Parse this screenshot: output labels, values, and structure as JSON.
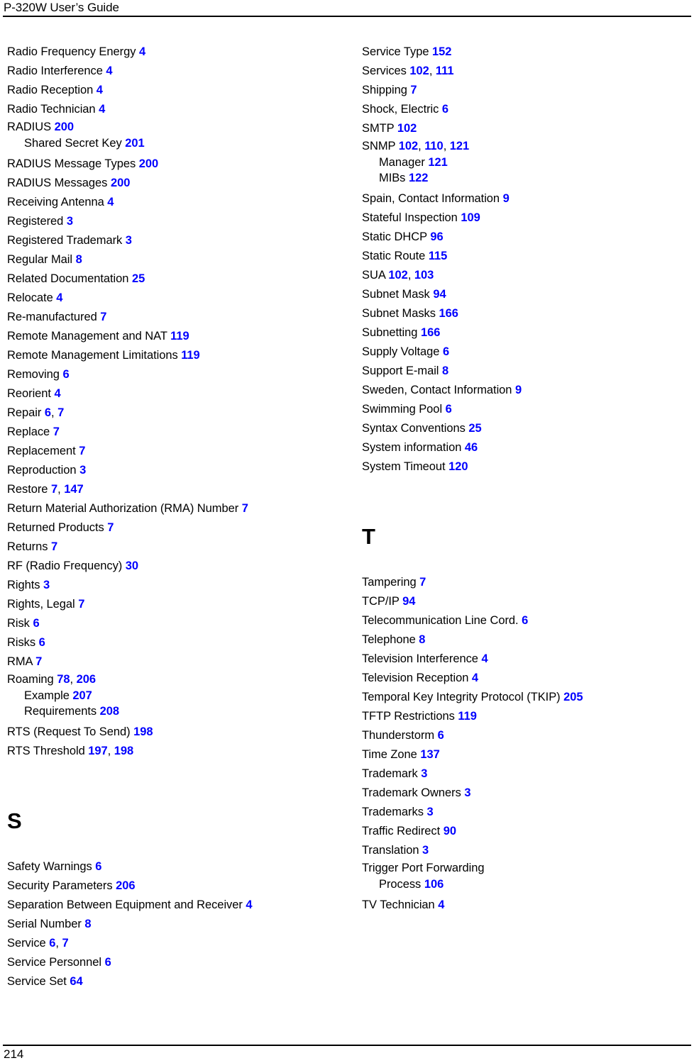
{
  "header": {
    "title": "P-320W User’s Guide"
  },
  "footer": {
    "page_number": "214"
  },
  "style": {
    "page_ref_color": "#0000ff",
    "text_color": "#000000",
    "background": "#ffffff"
  },
  "columns": [
    {
      "name": "left",
      "sections": [
        {
          "letter": null,
          "entries": [
            {
              "term": "Radio Frequency Energy",
              "pages": [
                "4"
              ],
              "level": 0
            },
            {
              "term": "Radio Interference",
              "pages": [
                "4"
              ],
              "level": 0
            },
            {
              "term": "Radio Reception",
              "pages": [
                "4"
              ],
              "level": 0
            },
            {
              "term": "Radio Technician",
              "pages": [
                "4"
              ],
              "level": 0
            },
            {
              "term": "RADIUS",
              "pages": [
                "200"
              ],
              "level": 0
            },
            {
              "term": "Shared Secret Key",
              "pages": [
                "201"
              ],
              "level": 1
            },
            {
              "term": "RADIUS Message Types",
              "pages": [
                "200"
              ],
              "level": 0
            },
            {
              "term": "RADIUS Messages",
              "pages": [
                "200"
              ],
              "level": 0
            },
            {
              "term": "Receiving Antenna",
              "pages": [
                "4"
              ],
              "level": 0
            },
            {
              "term": "Registered",
              "pages": [
                "3"
              ],
              "level": 0
            },
            {
              "term": "Registered Trademark",
              "pages": [
                "3"
              ],
              "level": 0
            },
            {
              "term": "Regular Mail",
              "pages": [
                "8"
              ],
              "level": 0
            },
            {
              "term": "Related Documentation",
              "pages": [
                "25"
              ],
              "level": 0
            },
            {
              "term": "Relocate",
              "pages": [
                "4"
              ],
              "level": 0
            },
            {
              "term": "Re-manufactured",
              "pages": [
                "7"
              ],
              "level": 0
            },
            {
              "term": "Remote Management and NAT",
              "pages": [
                "119"
              ],
              "level": 0
            },
            {
              "term": "Remote Management Limitations",
              "pages": [
                "119"
              ],
              "level": 0
            },
            {
              "term": "Removing",
              "pages": [
                "6"
              ],
              "level": 0
            },
            {
              "term": "Reorient",
              "pages": [
                "4"
              ],
              "level": 0
            },
            {
              "term": "Repair",
              "pages": [
                "6",
                "7"
              ],
              "level": 0
            },
            {
              "term": "Replace",
              "pages": [
                "7"
              ],
              "level": 0
            },
            {
              "term": "Replacement",
              "pages": [
                "7"
              ],
              "level": 0
            },
            {
              "term": "Reproduction",
              "pages": [
                "3"
              ],
              "level": 0
            },
            {
              "term": "Restore",
              "pages": [
                "7",
                "147"
              ],
              "level": 0
            },
            {
              "term": "Return Material Authorization (RMA) Number",
              "pages": [
                "7"
              ],
              "level": 0
            },
            {
              "term": "Returned Products",
              "pages": [
                "7"
              ],
              "level": 0
            },
            {
              "term": "Returns",
              "pages": [
                "7"
              ],
              "level": 0
            },
            {
              "term": "RF (Radio Frequency)",
              "pages": [
                "30"
              ],
              "level": 0
            },
            {
              "term": "Rights",
              "pages": [
                "3"
              ],
              "level": 0
            },
            {
              "term": "Rights, Legal",
              "pages": [
                "7"
              ],
              "level": 0
            },
            {
              "term": "Risk",
              "pages": [
                "6"
              ],
              "level": 0
            },
            {
              "term": "Risks",
              "pages": [
                "6"
              ],
              "level": 0
            },
            {
              "term": "RMA",
              "pages": [
                "7"
              ],
              "level": 0
            },
            {
              "term": "Roaming",
              "pages": [
                "78",
                "206"
              ],
              "level": 0
            },
            {
              "term": "Example",
              "pages": [
                "207"
              ],
              "level": 1
            },
            {
              "term": "Requirements",
              "pages": [
                "208"
              ],
              "level": 1
            },
            {
              "term": "RTS (Request To Send)",
              "pages": [
                "198"
              ],
              "level": 0
            },
            {
              "term": "RTS Threshold",
              "pages": [
                "197",
                "198"
              ],
              "level": 0
            }
          ]
        },
        {
          "letter": "S",
          "entries": [
            {
              "term": "Safety Warnings",
              "pages": [
                "6"
              ],
              "level": 0
            },
            {
              "term": "Security Parameters",
              "pages": [
                "206"
              ],
              "level": 0
            },
            {
              "term": "Separation Between Equipment and Receiver",
              "pages": [
                "4"
              ],
              "level": 0
            },
            {
              "term": "Serial Number",
              "pages": [
                "8"
              ],
              "level": 0
            },
            {
              "term": "Service",
              "pages": [
                "6",
                "7"
              ],
              "level": 0
            },
            {
              "term": "Service Personnel",
              "pages": [
                "6"
              ],
              "level": 0
            },
            {
              "term": "Service Set",
              "pages": [
                "64"
              ],
              "level": 0
            }
          ]
        }
      ]
    },
    {
      "name": "right",
      "sections": [
        {
          "letter": null,
          "entries": [
            {
              "term": "Service Type",
              "pages": [
                "152"
              ],
              "level": 0
            },
            {
              "term": "Services",
              "pages": [
                "102",
                "111"
              ],
              "level": 0
            },
            {
              "term": "Shipping",
              "pages": [
                "7"
              ],
              "level": 0
            },
            {
              "term": "Shock, Electric",
              "pages": [
                "6"
              ],
              "level": 0
            },
            {
              "term": "SMTP",
              "pages": [
                "102"
              ],
              "level": 0
            },
            {
              "term": "SNMP",
              "pages": [
                "102",
                "110",
                "121"
              ],
              "level": 0
            },
            {
              "term": "Manager",
              "pages": [
                "121"
              ],
              "level": 1
            },
            {
              "term": "MIBs",
              "pages": [
                "122"
              ],
              "level": 1
            },
            {
              "term": "Spain, Contact Information",
              "pages": [
                "9"
              ],
              "level": 0
            },
            {
              "term": "Stateful Inspection",
              "pages": [
                "109"
              ],
              "level": 0
            },
            {
              "term": "Static DHCP",
              "pages": [
                "96"
              ],
              "level": 0
            },
            {
              "term": "Static Route",
              "pages": [
                "115"
              ],
              "level": 0
            },
            {
              "term": "SUA",
              "pages": [
                "102",
                "103"
              ],
              "level": 0
            },
            {
              "term": "Subnet Mask",
              "pages": [
                "94"
              ],
              "level": 0
            },
            {
              "term": "Subnet Masks",
              "pages": [
                "166"
              ],
              "level": 0
            },
            {
              "term": "Subnetting",
              "pages": [
                "166"
              ],
              "level": 0
            },
            {
              "term": "Supply Voltage",
              "pages": [
                "6"
              ],
              "level": 0
            },
            {
              "term": "Support E-mail",
              "pages": [
                "8"
              ],
              "level": 0
            },
            {
              "term": "Sweden, Contact Information",
              "pages": [
                "9"
              ],
              "level": 0
            },
            {
              "term": "Swimming Pool",
              "pages": [
                "6"
              ],
              "level": 0
            },
            {
              "term": "Syntax Conventions",
              "pages": [
                "25"
              ],
              "level": 0
            },
            {
              "term": "System information",
              "pages": [
                "46"
              ],
              "level": 0
            },
            {
              "term": "System Timeout",
              "pages": [
                "120"
              ],
              "level": 0
            }
          ]
        },
        {
          "letter": "T",
          "entries": [
            {
              "term": "Tampering",
              "pages": [
                "7"
              ],
              "level": 0
            },
            {
              "term": "TCP/IP",
              "pages": [
                "94"
              ],
              "level": 0
            },
            {
              "term": "Telecommunication Line Cord.",
              "pages": [
                "6"
              ],
              "level": 0
            },
            {
              "term": "Telephone",
              "pages": [
                "8"
              ],
              "level": 0
            },
            {
              "term": "Television Interference",
              "pages": [
                "4"
              ],
              "level": 0
            },
            {
              "term": "Television Reception",
              "pages": [
                "4"
              ],
              "level": 0
            },
            {
              "term": "Temporal Key Integrity Protocol (TKIP)",
              "pages": [
                "205"
              ],
              "level": 0
            },
            {
              "term": "TFTP Restrictions",
              "pages": [
                "119"
              ],
              "level": 0
            },
            {
              "term": "Thunderstorm",
              "pages": [
                "6"
              ],
              "level": 0
            },
            {
              "term": "Time Zone",
              "pages": [
                "137"
              ],
              "level": 0
            },
            {
              "term": "Trademark",
              "pages": [
                "3"
              ],
              "level": 0
            },
            {
              "term": "Trademark Owners",
              "pages": [
                "3"
              ],
              "level": 0
            },
            {
              "term": "Trademarks",
              "pages": [
                "3"
              ],
              "level": 0
            },
            {
              "term": "Traffic Redirect",
              "pages": [
                "90"
              ],
              "level": 0
            },
            {
              "term": "Translation",
              "pages": [
                "3"
              ],
              "level": 0
            },
            {
              "term": "Trigger Port Forwarding",
              "pages": [],
              "level": 0
            },
            {
              "term": "Process",
              "pages": [
                "106"
              ],
              "level": 1
            },
            {
              "term": "TV Technician",
              "pages": [
                "4"
              ],
              "level": 0
            }
          ]
        }
      ]
    }
  ]
}
